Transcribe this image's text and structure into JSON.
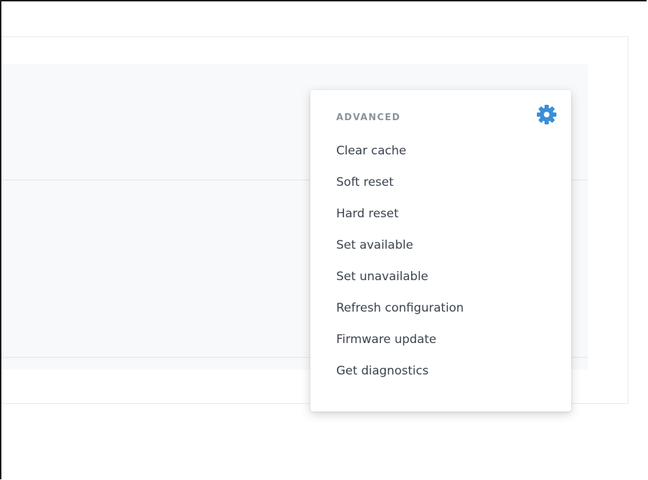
{
  "menu": {
    "header": "ADVANCED",
    "gear_icon": "gear-icon",
    "accent_color": "#3a8fd9",
    "items": [
      "Clear cache",
      "Soft reset",
      "Hard reset",
      "Set available",
      "Set unavailable",
      "Refresh configuration",
      "Firmware update",
      "Get diagnostics"
    ]
  }
}
